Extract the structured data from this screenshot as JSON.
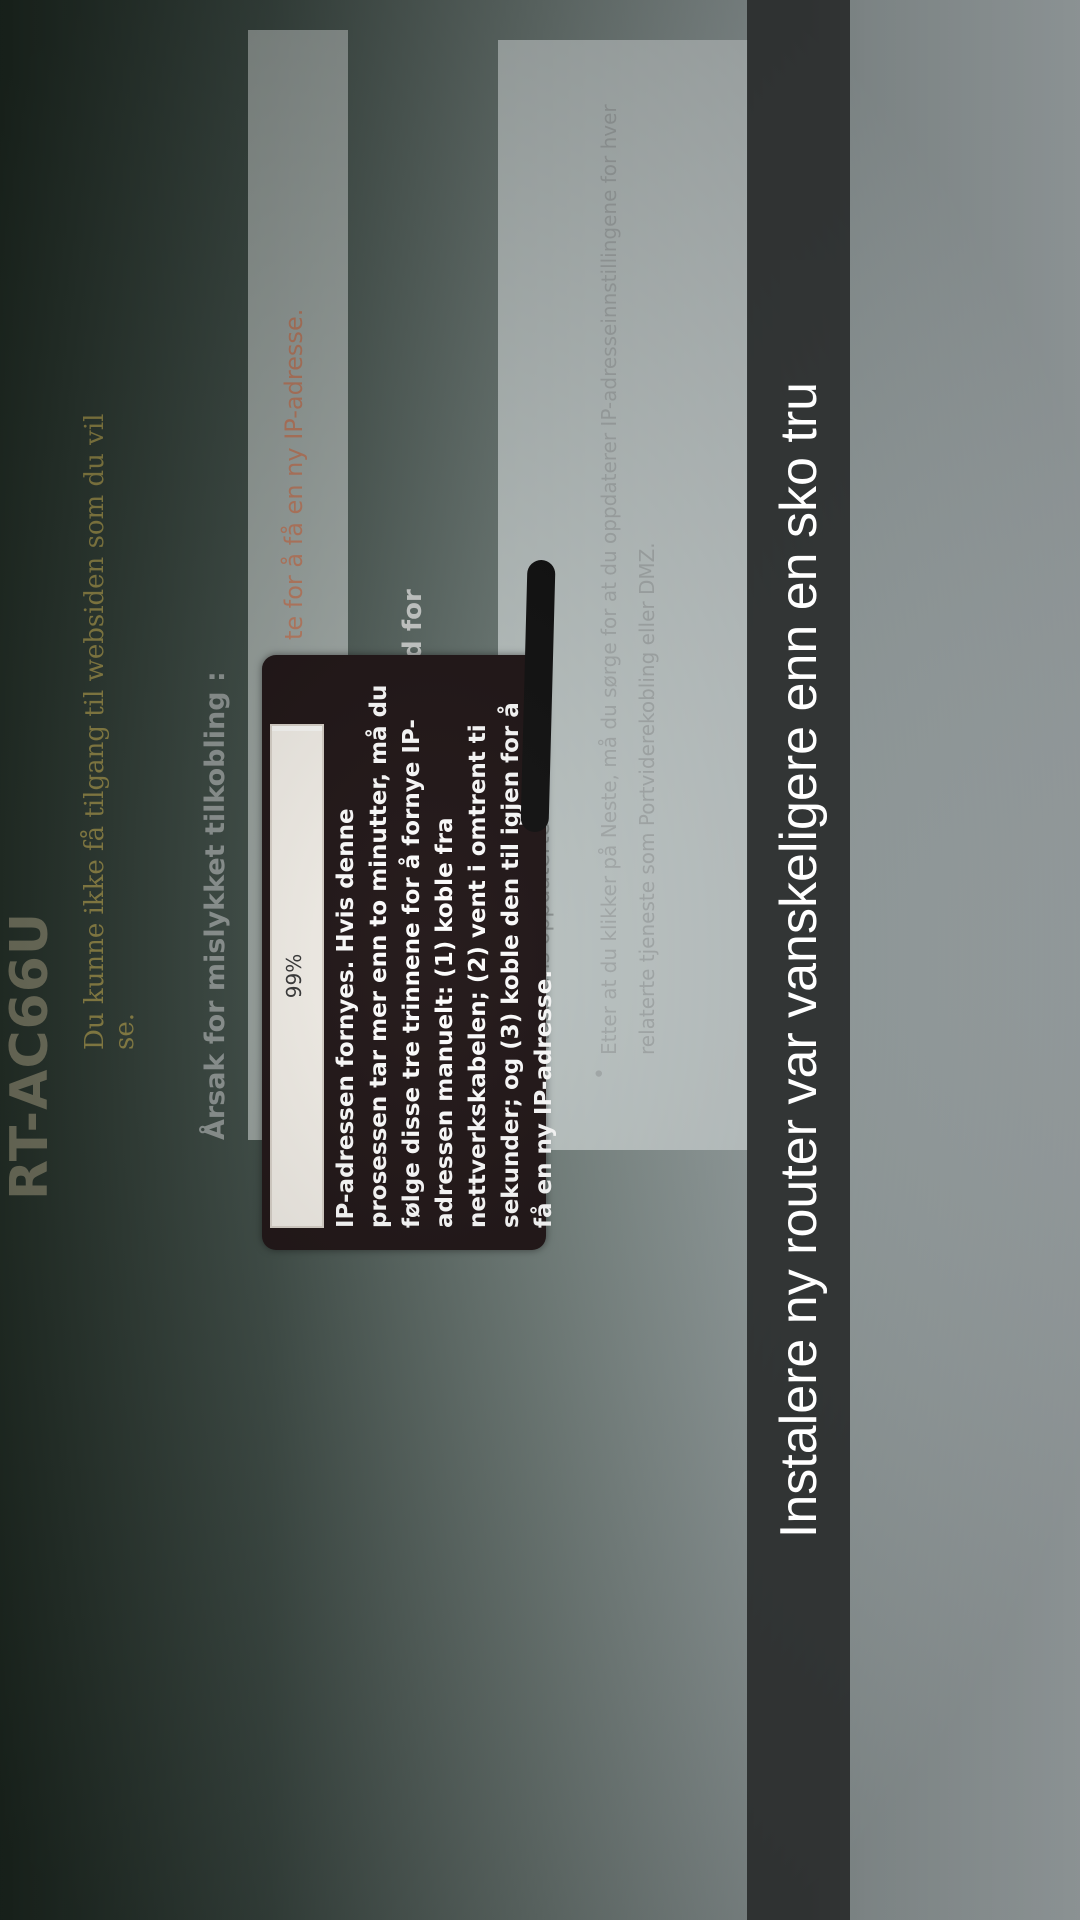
{
  "router_page": {
    "title": "RT-AC66U",
    "subtitle": "Du kunne ikke få tilgang til websiden som du vil se.",
    "reason_heading": "Årsak for mislykket tilkobling :",
    "reason_text": "te for å få en ny IP-adresse.",
    "user_text": "nto og passord for",
    "updated_ip_heading": "Ruterens oppdaterte IP-adresse",
    "info_text": "Etter at du klikker på Neste, må du sørge for at du oppdaterer IP-adresseinnstillingene for hver relaterte tjeneste som Portviderekobling eller DMZ."
  },
  "dialog": {
    "progress_label": "99%",
    "progress": 0.99,
    "message": "IP-adressen fornyes. Hvis denne prosessen tar mer enn to minutter, må du følge disse tre trinnene for å fornye IP-adressen manuelt: (1) koble fra nettverkskabelen; (2) vent i omtrent ti sekunder; og (3) koble den til igjen for å få en ny IP-adresse."
  },
  "caption": {
    "text": "Instalere ny router var vanskeligere enn en sko tru"
  }
}
